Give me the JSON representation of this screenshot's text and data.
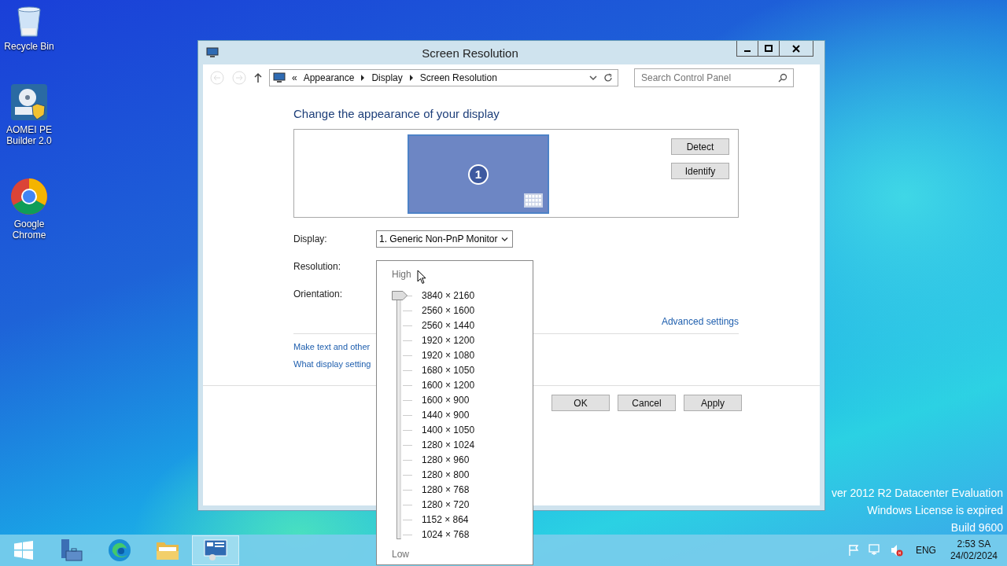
{
  "desktop_icons": [
    {
      "kind": "recycle",
      "label": "Recycle Bin"
    },
    {
      "kind": "installer",
      "label": "AOMEI PE Builder 2.0"
    },
    {
      "kind": "chrome",
      "label": "Google Chrome"
    }
  ],
  "window": {
    "title": "Screen Resolution",
    "breadcrumb_prefix": "«",
    "breadcrumb": [
      "Appearance",
      "Display",
      "Screen Resolution"
    ],
    "search": {
      "placeholder": "Search Control Panel"
    },
    "heading": "Change the appearance of your display",
    "monitor": {
      "number": "1"
    },
    "side_buttons": [
      "Detect",
      "Identify"
    ],
    "fields": [
      {
        "label": "Display:",
        "value": "1. Generic Non-PnP Monitor"
      },
      {
        "label": "Resolution:"
      },
      {
        "label": "Orientation:"
      }
    ],
    "advanced_link": "Advanced settings",
    "links": [
      "Make text and other",
      "What display setting"
    ],
    "buttons": [
      "OK",
      "Cancel",
      "Apply"
    ]
  },
  "resolution_popup": {
    "high_label": "High",
    "low_label": "Low",
    "level": 1,
    "options": [
      "3840 × 2160",
      "2560 × 1600",
      "2560 × 1440",
      "1920 × 1200",
      "1920 × 1080",
      "1680 × 1050",
      "1600 × 1200",
      "1600 × 900",
      "1440 × 900",
      "1400 × 1050",
      "1280 × 1024",
      "1280 × 960",
      "1280 × 800",
      "1280 × 768",
      "1280 × 720",
      "1152 × 864",
      "1024 × 768"
    ]
  },
  "evaluation_notice": [
    "ver 2012 R2 Datacenter Evaluation",
    "Windows License is expired",
    "Build 9600"
  ],
  "taskbar": {
    "apps": [
      {
        "kind": "start",
        "selected": false
      },
      {
        "kind": "server-manager",
        "selected": false
      },
      {
        "kind": "edge",
        "selected": false
      },
      {
        "kind": "explorer",
        "selected": false
      },
      {
        "kind": "control-panel",
        "selected": true
      }
    ],
    "language": "ENG",
    "time": "2:53 SA",
    "date": "24/02/2024"
  }
}
